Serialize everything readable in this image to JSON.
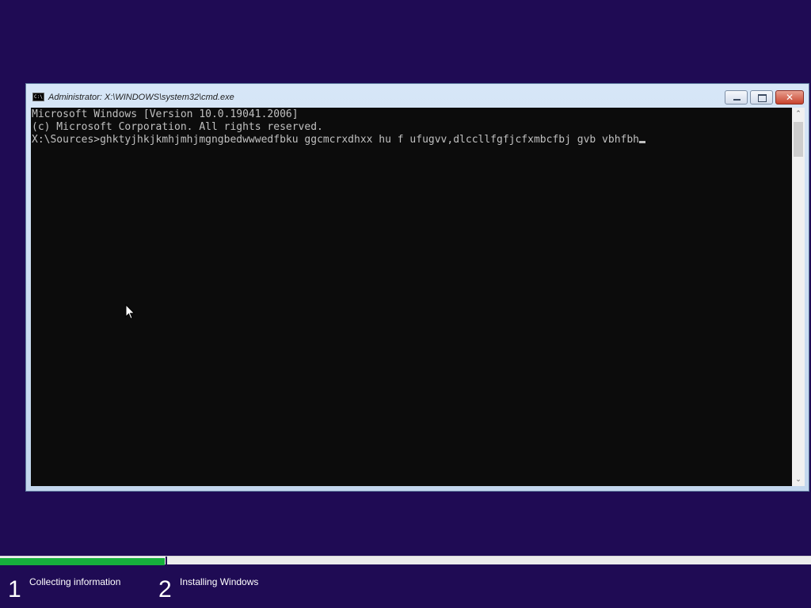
{
  "window": {
    "title": "Administrator: X:\\WINDOWS\\system32\\cmd.exe",
    "icon_text": "C:\\",
    "controls": {
      "minimize": "minimize",
      "maximize": "maximize",
      "close": "✕"
    }
  },
  "console": {
    "lines": [
      "Microsoft Windows [Version 10.0.19041.2006]",
      "(c) Microsoft Corporation. All rights reserved.",
      "",
      "X:\\Sources>ghktyjhkjkmhjmhjmgngbedwwwedfbku ggcmcrxdhxx hu f ufugvv,dlccllfgfjcfxmbcfbj gvb vbhfbh"
    ],
    "background": "#0c0c0c",
    "text_color": "#c0c0c0"
  },
  "scrollbar": {
    "up_arrow": "⌃",
    "down_arrow": "⌄"
  },
  "setup": {
    "progress_fraction": 0.205,
    "steps": [
      {
        "number": "1",
        "label": "Collecting information"
      },
      {
        "number": "2",
        "label": "Installing Windows"
      }
    ],
    "colors": {
      "background": "#1f0b54",
      "progress": "#16b03c"
    }
  }
}
